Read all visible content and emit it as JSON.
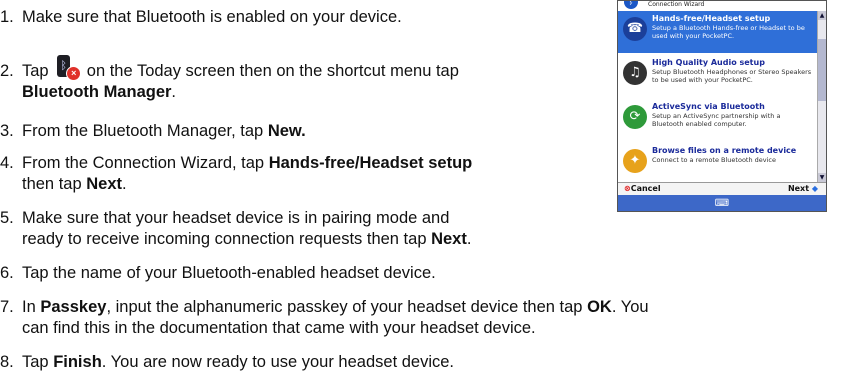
{
  "steps": [
    {
      "num": "1.",
      "pre": "Make sure that Bluetooth is enabled on your device."
    },
    {
      "num": "2.",
      "pre": "Tap",
      "mid": " on the Today screen then on the shortcut menu tap",
      "bold": "Bluetooth Manager",
      "post": "."
    },
    {
      "num": "3.",
      "pre": "From the Bluetooth Manager, tap ",
      "bold": "New."
    },
    {
      "num": "4.",
      "pre": "From the Connection Wizard, tap ",
      "bold": "Hands-free/Headset setup",
      "cont_pre": "then tap ",
      "cont_bold": "Next",
      "cont_post": "."
    },
    {
      "num": "5.",
      "pre": "Make sure that your headset device is in pairing mode and",
      "cont_pre": "ready to receive incoming connection requests then tap ",
      "cont_bold": "Next",
      "cont_post": "."
    },
    {
      "num": "6.",
      "pre": "Tap the name of your Bluetooth-enabled headset device."
    },
    {
      "num": "7.",
      "pre": "In ",
      "bold": "Passkey",
      "mid": ", input the alphanumeric passkey of your headset device then tap ",
      "bold2": "OK",
      "post": ". You",
      "cont_pre": "can find this in the documentation that came with your headset device."
    },
    {
      "num": "8.",
      "pre": "Tap ",
      "bold": "Finish",
      "post": ". You are now ready to use your headset device."
    }
  ],
  "device": {
    "title": "Connection Wizard",
    "items": [
      {
        "title": "Hands-free/Headset setup",
        "desc": "Setup a Bluetooth Hands-free or Headset to be used with your PocketPC.",
        "icon": "headset-icon",
        "glyph": "☎",
        "color": "#2f6fd8"
      },
      {
        "title": "High Quality Audio setup",
        "desc": "Setup Bluetooth Headphones or Stereo Speakers to be used with your PocketPC.",
        "icon": "headphones-icon",
        "glyph": "♫",
        "color": "#333333"
      },
      {
        "title": "ActiveSync via Bluetooth",
        "desc": "Setup an ActiveSync partnership with a Bluetooth enabled computer.",
        "icon": "activesync-icon",
        "glyph": "⟳",
        "color": "#2e9a3a"
      },
      {
        "title": "Browse files on a remote device",
        "desc": "Connect to a remote Bluetooth device",
        "icon": "folder-icon",
        "glyph": "✦",
        "color": "#e7a21b"
      }
    ],
    "cancel_label": "Cancel",
    "next_label": "Next",
    "menu_glyph": "⌨"
  }
}
